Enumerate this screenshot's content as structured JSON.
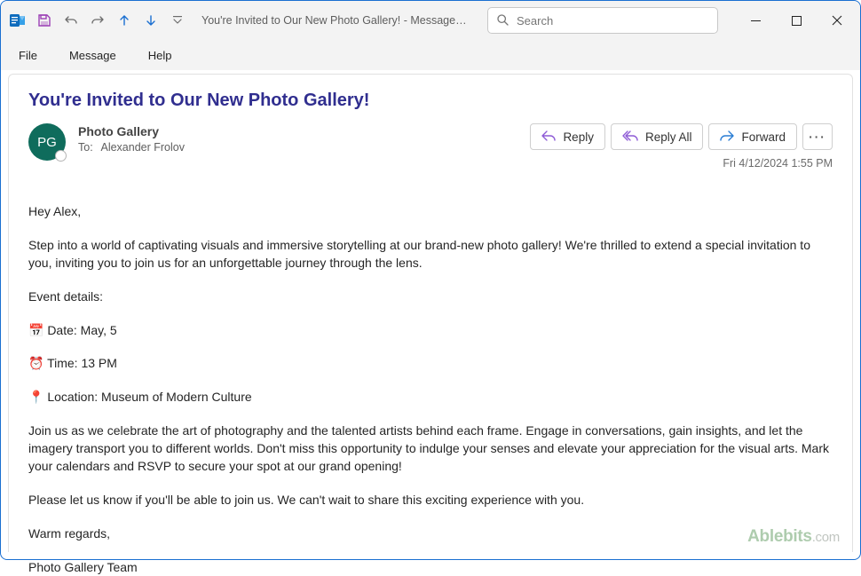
{
  "window": {
    "title": "You're Invited to Our New Photo Gallery!  -  Message (HT..."
  },
  "search": {
    "placeholder": "Search"
  },
  "menu": {
    "file": "File",
    "message": "Message",
    "help": "Help"
  },
  "email": {
    "subject": "You're Invited to Our New Photo Gallery!",
    "avatar_initials": "PG",
    "sender_name": "Photo Gallery",
    "to_label": "To:",
    "to_value": "Alexander Frolov",
    "timestamp": "Fri 4/12/2024 1:55 PM"
  },
  "actions": {
    "reply": "Reply",
    "reply_all": "Reply All",
    "forward": "Forward",
    "more": "···"
  },
  "body": {
    "greeting": "Hey Alex,",
    "intro": "Step into a world of captivating visuals and immersive storytelling at our brand-new photo gallery! We're thrilled to extend a special invitation to you, inviting you to join us for an unforgettable journey through the lens.",
    "event_details_label": " Event details:",
    "date_line": "📅 Date: May, 5",
    "time_line": "⏰ Time: 13 PM",
    "location_line": "📍 Location: Museum of Modern Culture",
    "para2": "Join us as we celebrate the art of photography and the talented artists behind each frame. Engage in conversations, gain insights, and let the imagery transport you to different worlds. Don't miss this opportunity to indulge your senses and elevate your appreciation for the visual arts. Mark your calendars and RSVP to secure your spot at our grand opening!",
    "para3": "Please let us know if you'll be able to join us. We can't wait to share this exciting experience with you.",
    "closing1": " Warm regards,",
    "closing2": "Photo Gallery Team"
  },
  "watermark": {
    "brand": "Ablebits",
    "domain": ".com"
  }
}
